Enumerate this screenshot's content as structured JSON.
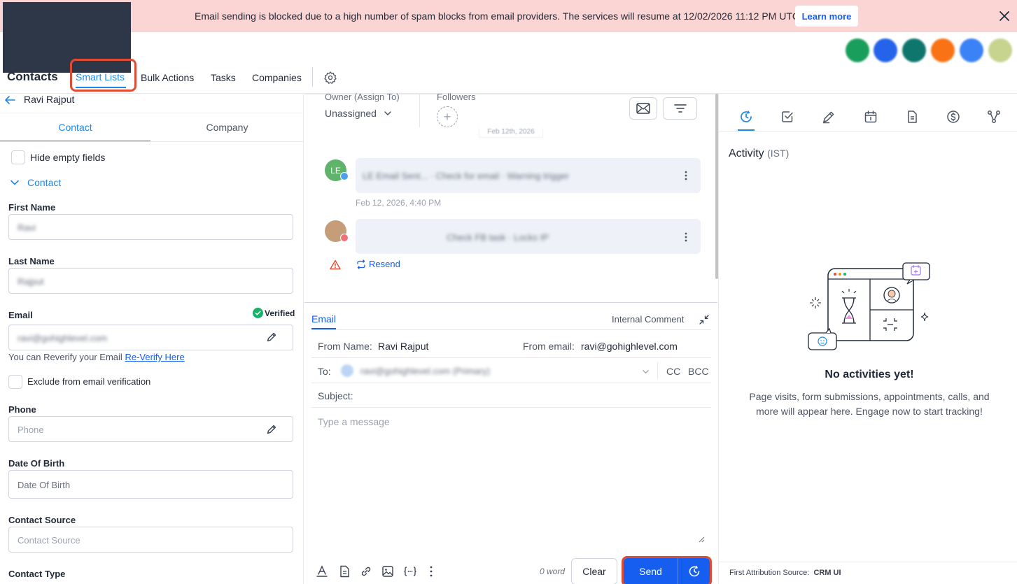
{
  "banner": {
    "message": "Email sending is blocked due to a high number of spam blocks from email providers. The services will resume at 12/02/2026 11:12 PM UTC.",
    "learn_more": "Learn more"
  },
  "app_icons": [
    {
      "icon": "phone-icon",
      "color": "#1a9e5c"
    },
    {
      "icon": "link-icon",
      "color": "#2563eb"
    },
    {
      "icon": "chat-icon",
      "color": "#0f766e"
    },
    {
      "icon": "bell-icon",
      "color": "#f97316"
    },
    {
      "icon": "help-icon",
      "color": "#3b82f6"
    },
    {
      "icon": "avatar-icon",
      "color": "#c7d48f"
    }
  ],
  "nav": {
    "contacts": "Contacts",
    "smart_lists": "Smart Lists",
    "bulk_actions": "Bulk Actions",
    "tasks": "Tasks",
    "companies": "Companies"
  },
  "contact": {
    "name": "Ravi Rajput",
    "tabs": {
      "contact": "Contact",
      "company": "Company"
    },
    "hide_empty": "Hide empty fields",
    "section": "Contact",
    "fields": {
      "first_name": {
        "label": "First Name",
        "value": "Ravi"
      },
      "last_name": {
        "label": "Last Name",
        "value": "Rajput"
      },
      "email": {
        "label": "Email",
        "value": "ravi@gohighlevel.com",
        "verified": "Verified"
      },
      "reverify_text": "You can Reverify your Email",
      "reverify_link": "Re-Verify Here",
      "exclude": "Exclude from email verification",
      "phone": {
        "label": "Phone",
        "placeholder": "Phone"
      },
      "dob": {
        "label": "Date Of Birth",
        "placeholder": "Date Of Birth"
      },
      "source": {
        "label": "Contact Source",
        "placeholder": "Contact Source"
      },
      "type": {
        "label": "Contact Type"
      }
    }
  },
  "conversation": {
    "owner_label": "Owner (Assign To)",
    "owner_value": "Unassigned",
    "followers_label": "Followers",
    "followers_add": "+",
    "date_divider": "Feb 12th, 2026",
    "messages": [
      {
        "initials": "LE",
        "text": "LE Email Sent... · Check for email · Warning trigger",
        "time": "Feb 12, 2026, 4:40 PM"
      },
      {
        "initials": "",
        "text": "Check FB task · Locks IP"
      }
    ],
    "resend": "Resend"
  },
  "composer": {
    "tab_email": "Email",
    "tab_internal": "Internal Comment",
    "from_name_label": "From Name:",
    "from_name_value": "Ravi Rajput",
    "from_email_label": "From email:",
    "from_email_value": "ravi@gohighlevel.com",
    "to_label": "To:",
    "to_value": "ravi@gohighlevel.com (Primary)",
    "cc": "CC",
    "bcc": "BCC",
    "subject_label": "Subject:",
    "message_placeholder": "Type a message",
    "word_count": "0 word",
    "clear": "Clear",
    "send": "Send"
  },
  "activity": {
    "title": "Activity",
    "tz": "(IST)",
    "empty_title": "No activities yet!",
    "empty_desc": "Page visits, form submissions, appointments, calls, and more will appear here. Engage now to start tracking!",
    "attribution_label": "First Attribution Source:",
    "attribution_value": "CRM UI"
  },
  "colors": {
    "accent": "#155eef",
    "banner_bg": "#fbd5d3",
    "highlight": "#e04b34"
  }
}
